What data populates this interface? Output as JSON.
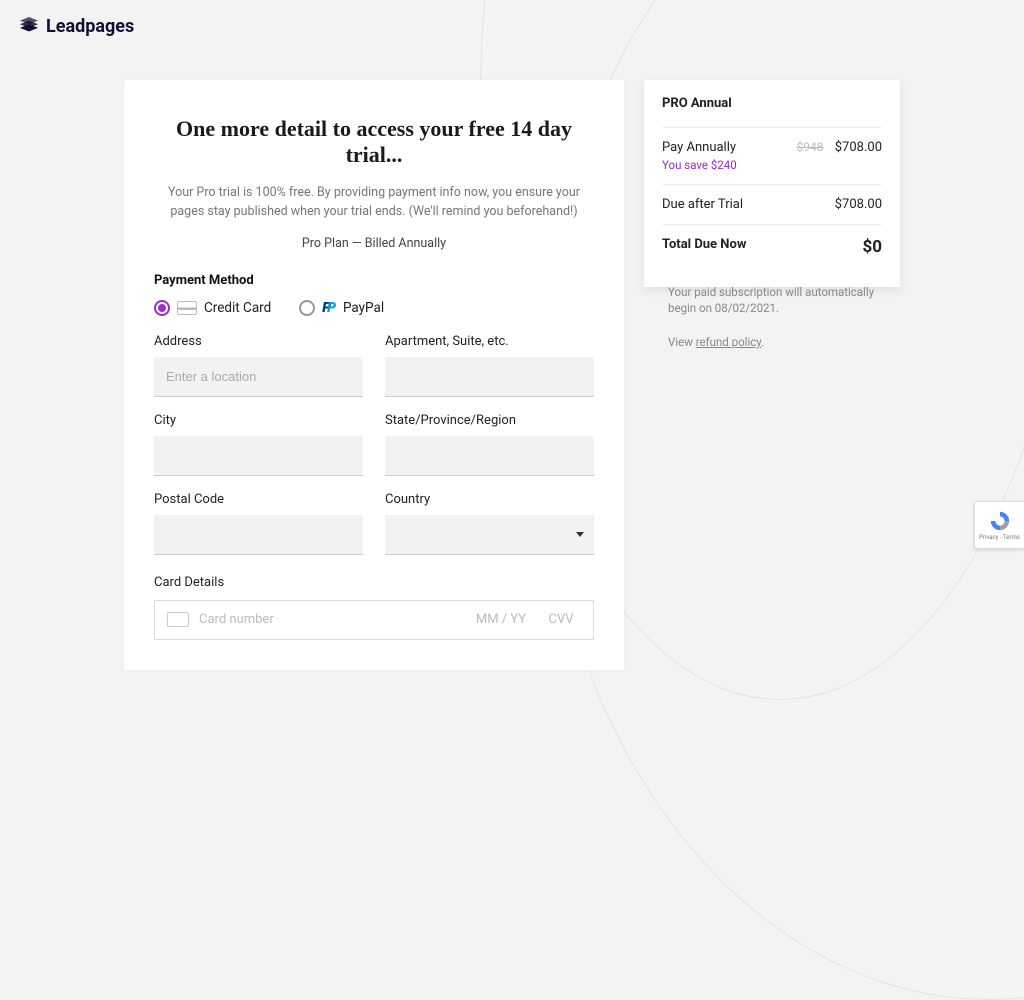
{
  "brand": {
    "name": "Leadpages"
  },
  "headline": "One more detail to access your free 14 day trial...",
  "subtext": "Your Pro trial is 100% free. By providing payment info now, you ensure your pages stay published when your trial ends. (We'll remind you beforehand!)",
  "plan_line": "Pro Plan — Billed Annually",
  "payment_method": {
    "label": "Payment Method",
    "options": {
      "credit_card": "Credit Card",
      "paypal": "PayPal"
    }
  },
  "address": {
    "address_label": "Address",
    "address_placeholder": "Enter a location",
    "apt_label": "Apartment, Suite, etc.",
    "city_label": "City",
    "state_label": "State/Province/Region",
    "postal_label": "Postal Code",
    "country_label": "Country"
  },
  "card": {
    "section_label": "Card Details",
    "number_placeholder": "Card number",
    "expiry_placeholder": "MM / YY",
    "cvv_placeholder": "CVV"
  },
  "summary": {
    "title": "PRO Annual",
    "pay_annually_label": "Pay Annually",
    "save_text": "You save $240",
    "original_price": "$948",
    "price": "$708.00",
    "due_after_label": "Due after Trial",
    "due_after_value": "$708.00",
    "total_label": "Total Due Now",
    "total_value": "$0"
  },
  "footnote": {
    "auto_text": "Your paid subscription will automatically begin on 08/02/2021.",
    "view_prefix": "View ",
    "refund_link": "refund policy",
    "period": "."
  },
  "recaptcha": {
    "privacy": "Privacy",
    "terms": "Terms",
    "sep": " - "
  }
}
